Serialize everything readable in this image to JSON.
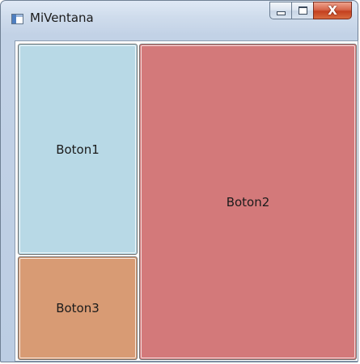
{
  "window": {
    "title": "MiVentana",
    "caption_buttons": {
      "minimize_icon": "minimize-icon",
      "maximize_icon": "maximize-icon",
      "close_icon": "close-icon",
      "close_glyph": "X"
    }
  },
  "buttons": {
    "boton1": {
      "label": "Boton1",
      "color": "#b8d9e6"
    },
    "boton2": {
      "label": "Boton2",
      "color": "#d3797a"
    },
    "boton3": {
      "label": "Boton3",
      "color": "#d89b74"
    }
  }
}
